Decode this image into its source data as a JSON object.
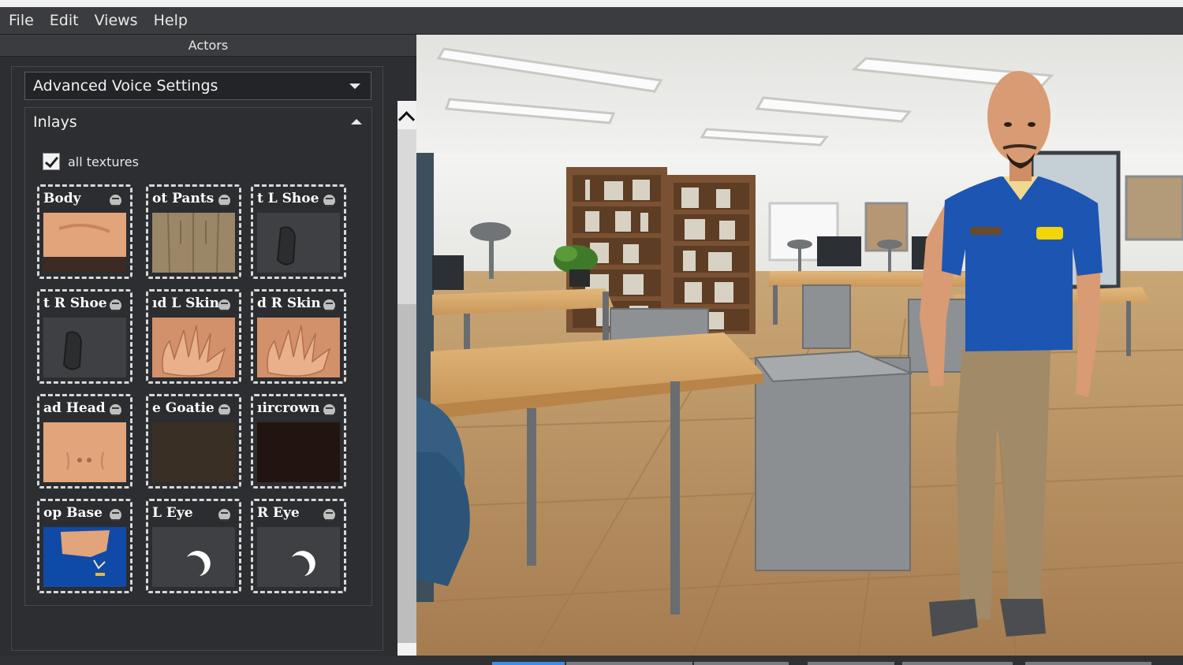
{
  "menu": {
    "items": [
      "File",
      "Edit",
      "Views",
      "Help"
    ]
  },
  "panel": {
    "title": "Actors",
    "voice_dropdown": {
      "value": "Advanced Voice Settings",
      "icon": "chevron-down-icon"
    },
    "inlays": {
      "title": "Inlays",
      "icon": "chevron-up-icon",
      "all_textures": {
        "label": "all textures",
        "checked": true
      },
      "tiles": [
        {
          "label": "Body",
          "icon": "texture-menu-icon",
          "thumb": "skin-body"
        },
        {
          "label": "ot Pants",
          "icon": "texture-menu-icon",
          "thumb": "pants"
        },
        {
          "label": "t L Shoe",
          "icon": "texture-menu-icon",
          "thumb": "shoe"
        },
        {
          "label": "t R Shoe",
          "icon": "texture-menu-icon",
          "thumb": "shoe"
        },
        {
          "label": "ıd L Skin",
          "icon": "texture-menu-icon",
          "thumb": "hand"
        },
        {
          "label": "d R Skin",
          "icon": "texture-menu-icon",
          "thumb": "hand"
        },
        {
          "label": "ad Head",
          "icon": "texture-menu-icon",
          "thumb": "head"
        },
        {
          "label": "e Goatie",
          "icon": "texture-menu-icon",
          "thumb": "goatie"
        },
        {
          "label": "ıircrown",
          "icon": "texture-menu-icon",
          "thumb": "haircrown"
        },
        {
          "label": "op Base",
          "icon": "texture-menu-icon",
          "thumb": "shirt"
        },
        {
          "label": "L Eye",
          "icon": "texture-menu-icon",
          "thumb": "eye"
        },
        {
          "label": "R Eye",
          "icon": "texture-menu-icon",
          "thumb": "eye"
        }
      ]
    }
  },
  "viewport": {
    "scene": "office-classroom-3d",
    "actor": "bald-man-blue-polo"
  },
  "colors": {
    "chrome": "#3a3c3f",
    "panel": "#2c2e31",
    "shirt": "#1d55b3",
    "pants": "#a08a68",
    "skin": "#d99b73",
    "floor": "#b58d5e"
  }
}
